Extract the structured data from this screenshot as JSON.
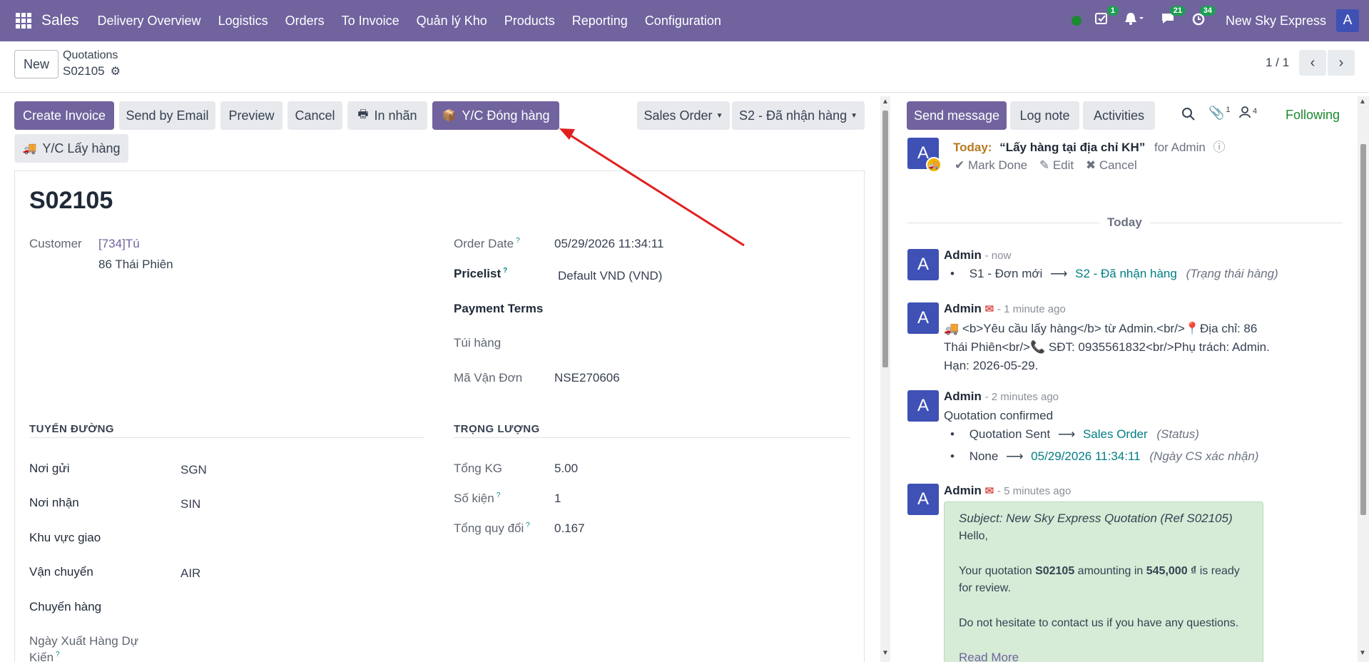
{
  "navbar": {
    "app_name": "Sales",
    "menu": [
      "Delivery Overview",
      "Logistics",
      "Orders",
      "To Invoice",
      "Quản lý Kho",
      "Products",
      "Reporting",
      "Configuration"
    ],
    "activity_count": "1",
    "messages_count": "21",
    "timer_count": "34",
    "company": "New Sky Express",
    "user_initial": "A"
  },
  "control_panel": {
    "new_label": "New",
    "breadcrumb_parent": "Quotations",
    "breadcrumb_current": "S02105",
    "pager": "1 / 1"
  },
  "actions": {
    "create_invoice": "Create Invoice",
    "send_email": "Send by Email",
    "preview": "Preview",
    "cancel": "Cancel",
    "in_nhan": "In nhãn",
    "yc_dong_hang": "Y/C Đóng hàng",
    "yc_lay_hang": "Y/C Lấy hàng",
    "sales_order": "Sales Order",
    "status_stage": "S2 - Đã nhận hàng"
  },
  "form": {
    "name": "S02105",
    "customer_label": "Customer",
    "customer_name": "[734]Tú",
    "customer_address": "86 Thái Phiên",
    "order_date_label": "Order Date",
    "order_date": "05/29/2026 11:34:11",
    "pricelist_label": "Pricelist",
    "pricelist": "Default VND (VND)",
    "payment_terms_label": "Payment Terms",
    "tui_hang_label": "Túi hàng",
    "ma_van_don_label": "Mã Vận Đơn",
    "ma_van_don": "NSE270606",
    "section_route": "TUYẾN ĐƯỜNG",
    "section_weight": "TRỌNG LƯỢNG",
    "noi_gui_label": "Nơi gửi",
    "noi_gui": "SGN",
    "noi_nhan_label": "Nơi nhận",
    "noi_nhan": "SIN",
    "khu_vuc_label": "Khu vực giao",
    "van_chuyen_label": "Vận chuyển",
    "van_chuyen": "AIR",
    "chuyen_hang_label": "Chuyến hàng",
    "ngay_xuat_label_1": "Ngày Xuất Hàng Dự",
    "ngay_xuat_label_2": "Kiến",
    "tong_kg_label": "Tổng KG",
    "tong_kg": "5.00",
    "so_kien_label": "Số kiện",
    "so_kien": "1",
    "tong_quy_doi_label": "Tổng quy đổi",
    "tong_quy_doi": "0.167",
    "help_mark": "?"
  },
  "chatter": {
    "send_message": "Send message",
    "log_note": "Log note",
    "activities": "Activities",
    "attachments_count": "1",
    "followers_count": "4",
    "following": "Following",
    "activity": {
      "today_label": "Today:",
      "summary": "“Lấy hàng tại địa chỉ KH”",
      "for_user": "for Admin",
      "mark_done": "Mark Done",
      "edit": "Edit",
      "cancel": "Cancel"
    },
    "separator": "Today",
    "messages": [
      {
        "author": "Admin",
        "time": "- now",
        "old": "S1 - Đơn mới",
        "new": "S2 - Đã nhận hàng",
        "field": "(Trạng thái hàng)"
      },
      {
        "author": "Admin",
        "time": "- 1 minute ago",
        "line1": "<b>Yêu cầu lấy hàng</b> từ Admin.<br/>",
        "line1b": "Địa chỉ: 86",
        "line2": "Thái Phiên<br/>",
        "line2b": "SĐT: 0935561832<br/>Phụ trách: Admin.",
        "line3": "Hạn: 2026-05-29."
      },
      {
        "author": "Admin",
        "time": "- 2 minutes ago",
        "body": "Quotation confirmed",
        "t1_old": "Quotation Sent",
        "t1_new": "Sales Order",
        "t1_field": "(Status)",
        "t2_old": "None",
        "t2_new": "05/29/2026 11:34:11",
        "t2_field": "(Ngày CS xác nhận)"
      },
      {
        "author": "Admin",
        "time": "- 5 minutes ago",
        "subject": "Subject: New Sky Express Quotation (Ref S02105)",
        "hello": "Hello,",
        "p1_a": "Your quotation ",
        "p1_ref": "S02105",
        "p1_b": " amounting in ",
        "p1_amount": "545,000 ₫",
        "p1_c": " is ready",
        "p1_d": "for review.",
        "p2": "Do not hesitate to contact us if you have any questions.",
        "read_more": "Read More"
      }
    ]
  },
  "colors": {
    "brand": "#71639e",
    "teal": "#017e84",
    "annotation_arrow": "#e02020"
  }
}
